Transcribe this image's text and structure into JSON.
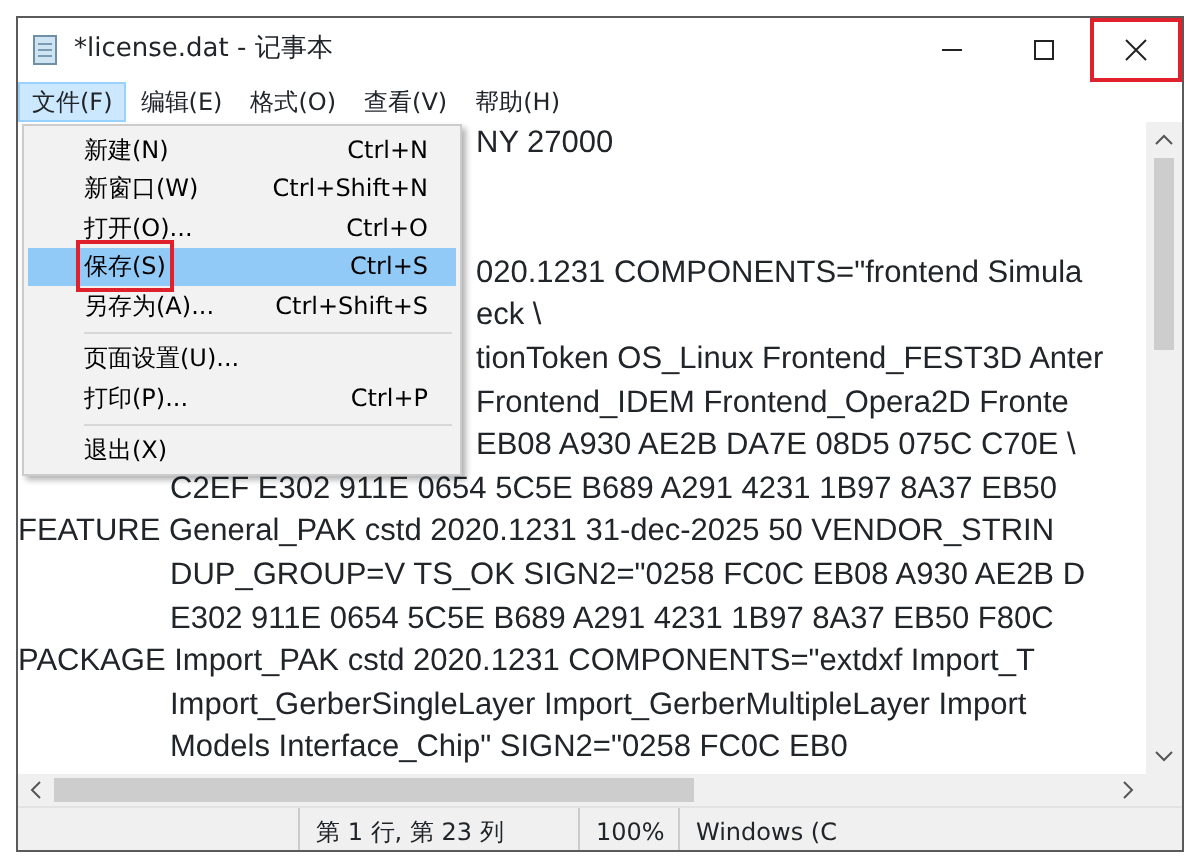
{
  "window": {
    "title": "*license.dat - 记事本",
    "close_highlighted": true
  },
  "menubar": [
    {
      "label": "文件(F)",
      "selected": true
    },
    {
      "label": "编辑(E)",
      "selected": false
    },
    {
      "label": "格式(O)",
      "selected": false
    },
    {
      "label": "查看(V)",
      "selected": false
    },
    {
      "label": "帮助(H)",
      "selected": false
    }
  ],
  "file_menu": [
    {
      "kind": "item",
      "label": "新建(N)",
      "shortcut": "Ctrl+N",
      "selected": false,
      "highlighted": false
    },
    {
      "kind": "item",
      "label": "新窗口(W)",
      "shortcut": "Ctrl+Shift+N",
      "selected": false,
      "highlighted": false
    },
    {
      "kind": "item",
      "label": "打开(O)...",
      "shortcut": "Ctrl+O",
      "selected": false,
      "highlighted": false
    },
    {
      "kind": "item",
      "label": "保存(S)",
      "shortcut": "Ctrl+S",
      "selected": true,
      "highlighted": true
    },
    {
      "kind": "item",
      "label": "另存为(A)...",
      "shortcut": "Ctrl+Shift+S",
      "selected": false,
      "highlighted": false
    },
    {
      "kind": "separator"
    },
    {
      "kind": "item",
      "label": "页面设置(U)...",
      "selected": false,
      "highlighted": false
    },
    {
      "kind": "item",
      "label": "打印(P)...",
      "shortcut": "Ctrl+P",
      "selected": false,
      "highlighted": false
    },
    {
      "kind": "separator"
    },
    {
      "kind": "item",
      "label": "退出(X)",
      "selected": false,
      "highlighted": false
    }
  ],
  "editor_lines": [
    {
      "kind": "after-menu",
      "text": "NY 27000"
    },
    {
      "kind": "blank"
    },
    {
      "kind": "blank"
    },
    {
      "kind": "after-menu",
      "text": "020.1231 COMPONENTS=\"frontend Simula"
    },
    {
      "kind": "after-menu",
      "text": "eck \\"
    },
    {
      "kind": "after-menu",
      "text": "tionToken OS_Linux Frontend_FEST3D Anter"
    },
    {
      "kind": "after-menu",
      "text": "Frontend_IDEM Frontend_Opera2D Fronte"
    },
    {
      "kind": "after-menu",
      "text": "EB08 A930 AE2B DA7E 08D5 075C C70E \\"
    },
    {
      "kind": "indent",
      "text": "C2EF E302 911E 0654 5C5E B689 A291 4231 1B97 8A37 EB50"
    },
    {
      "kind": "full",
      "text": "FEATURE General_PAK cstd 2020.1231 31-dec-2025 50 VENDOR_STRIN"
    },
    {
      "kind": "indent",
      "text": "DUP_GROUP=V TS_OK SIGN2=\"0258 FC0C EB08 A930 AE2B D"
    },
    {
      "kind": "indent",
      "text": "E302 911E 0654 5C5E B689 A291 4231 1B97 8A37 EB50 F80C"
    },
    {
      "kind": "full",
      "text": "PACKAGE Import_PAK cstd 2020.1231 COMPONENTS=\"extdxf Import_T"
    },
    {
      "kind": "indent",
      "text": "Import_GerberSingleLayer Import_GerberMultipleLayer Import"
    },
    {
      "kind": "indent",
      "text": "Models Interface_Chip\" SIGN2=\"0258 FC0C EB0"
    }
  ],
  "status_bar": {
    "position": "第 1 行, 第 23 列",
    "zoom": "100%",
    "encoding": "Windows (C"
  }
}
